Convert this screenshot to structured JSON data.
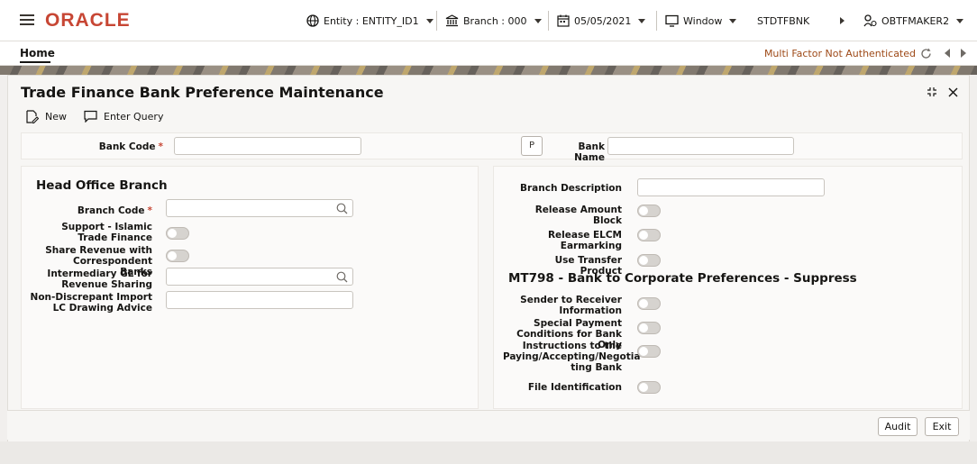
{
  "app": {
    "logo": "ORACLE"
  },
  "topbar": {
    "entity": "Entity : ENTITY_ID1",
    "branch": "Branch : 000",
    "date": "05/05/2021",
    "window": "Window",
    "branch_code": "STDTFBNK",
    "user": "OBTFMAKER2"
  },
  "homerow": {
    "tab": "Home",
    "mfa": "Multi Factor Not Authenticated"
  },
  "form": {
    "title": "Trade Finance Bank Preference Maintenance",
    "toolbar": {
      "new": "New",
      "enter_query": "Enter Query"
    },
    "header": {
      "bank_code_label": "Bank Code",
      "bank_code_value": "",
      "p_button": "P",
      "bank_name_label": "Bank Name",
      "bank_name_value": ""
    },
    "head_office": {
      "title": "Head Office Branch",
      "branch_code": "Branch Code",
      "support_islamic": "Support - Islamic Trade Finance",
      "share_revenue": "Share Revenue with Correspondent Banks",
      "intermediary_gl": "Intermediary GL for Revenue Sharing",
      "non_discrepant": "Non-Discrepant Import LC Drawing Advice"
    },
    "right": {
      "branch_description": "Branch Description",
      "release_amount_block": "Release Amount Block",
      "release_elcm": "Release ELCM Earmarking",
      "use_transfer": "Use Transfer Product",
      "mt798_title": "MT798 - Bank to Corporate Preferences - Suppress",
      "sender_receiver": "Sender to Receiver Information",
      "special_payment": "Special Payment Conditions for Bank Only",
      "instructions": "Instructions to the Paying/Accepting/Negotia ting Bank",
      "file_identification": "File Identification"
    },
    "footer": {
      "audit": "Audit",
      "exit": "Exit"
    }
  },
  "colors": {
    "brand": "#c74634",
    "mfa": "#9e4a18"
  }
}
